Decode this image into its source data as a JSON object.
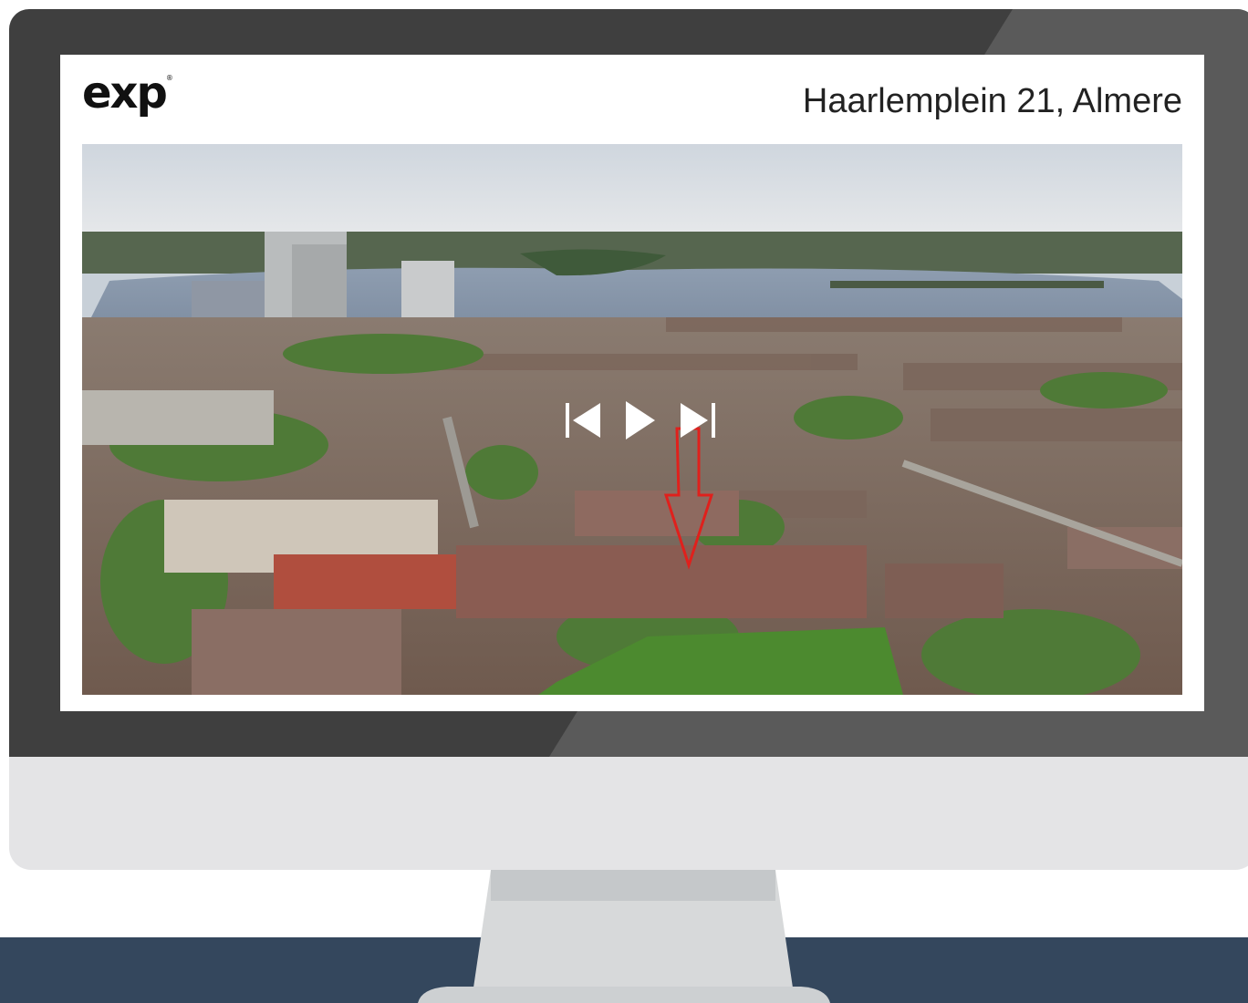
{
  "brand": {
    "logo_text": "exp",
    "logo_mark": "®"
  },
  "listing": {
    "address": "Haarlemplein 21, Almere"
  },
  "player": {
    "controls": [
      {
        "name": "previous-icon",
        "action": "previous"
      },
      {
        "name": "play-icon",
        "action": "play"
      },
      {
        "name": "next-icon",
        "action": "next"
      }
    ],
    "marker": "red-arrow-icon"
  },
  "colors": {
    "bezel": "#3f3f3f",
    "chin": "#e4e4e6",
    "floor": "#34475d",
    "marker": "#e0201c"
  }
}
